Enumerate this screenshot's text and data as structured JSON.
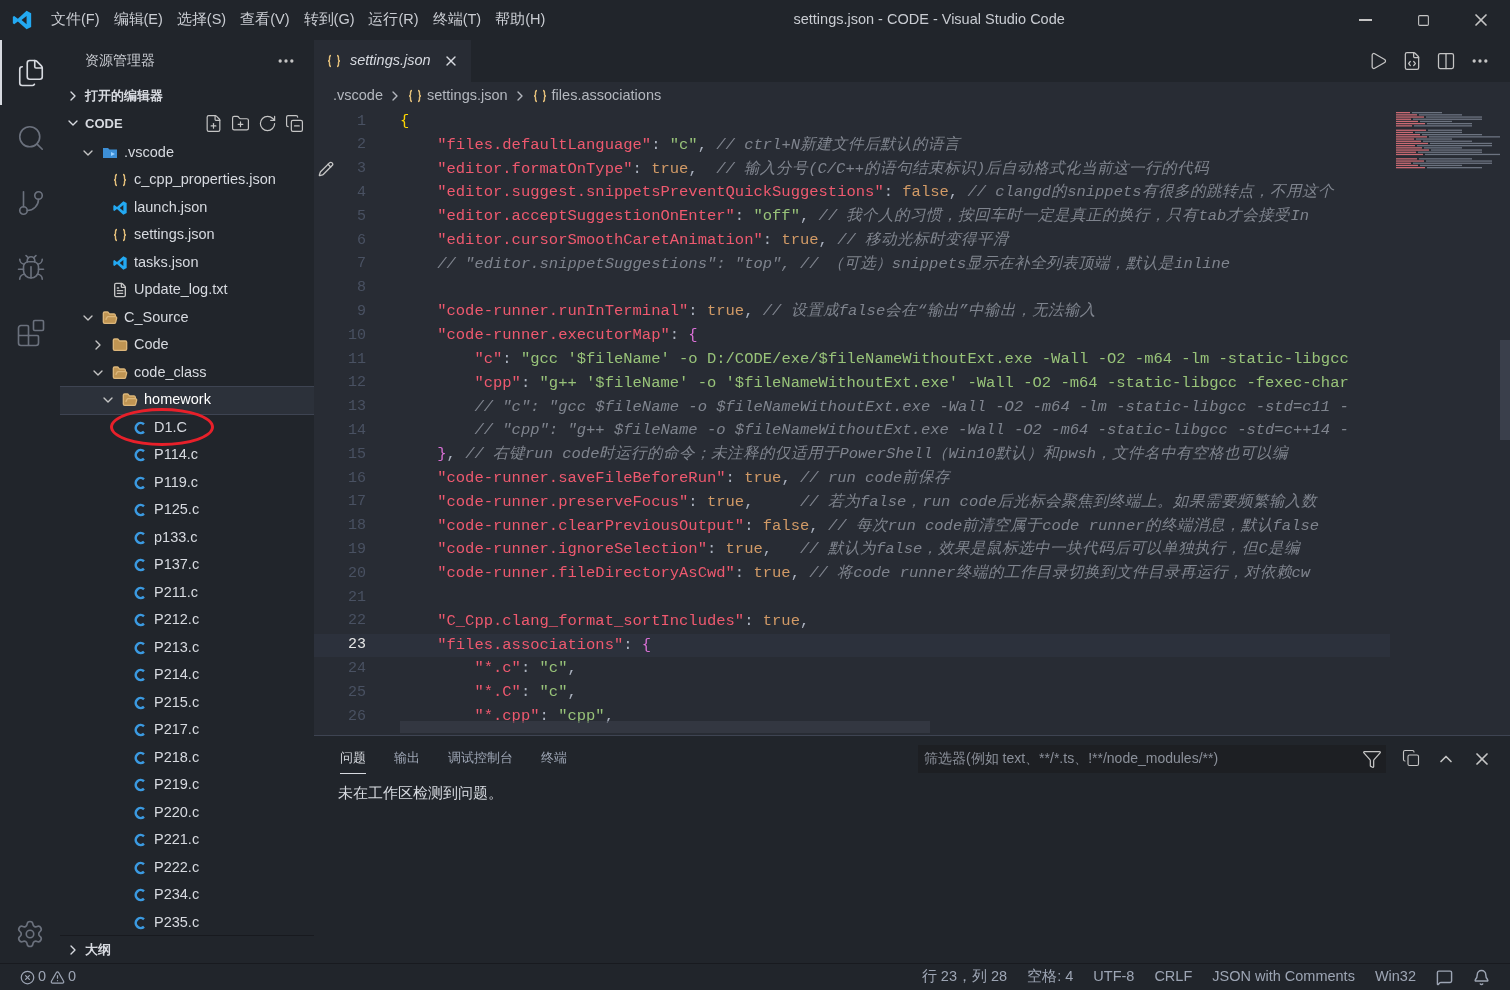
{
  "window": {
    "title": "settings.json - CODE - Visual Studio Code"
  },
  "menu": [
    "文件(F)",
    "编辑(E)",
    "选择(S)",
    "查看(V)",
    "转到(G)",
    "运行(R)",
    "终端(T)",
    "帮助(H)"
  ],
  "activity_bar": [
    {
      "kind": "files",
      "selected": true
    },
    {
      "kind": "search",
      "selected": false
    },
    {
      "kind": "source-control",
      "selected": false
    },
    {
      "kind": "run-debug",
      "selected": false
    },
    {
      "kind": "extensions",
      "selected": false
    }
  ],
  "sidebar": {
    "title": "资源管理器",
    "sections": [
      {
        "label": "打开的编辑器",
        "expanded": false
      },
      {
        "label": "CODE",
        "expanded": true
      }
    ],
    "tree": [
      {
        "name": ".vscode",
        "kind": "vscode-folder",
        "expanded": true,
        "selected": false,
        "children": [
          {
            "name": "c_cpp_properties.json",
            "kind": "json",
            "selected": false
          },
          {
            "name": "launch.json",
            "kind": "vscode",
            "selected": false
          },
          {
            "name": "settings.json",
            "kind": "json",
            "selected": false
          },
          {
            "name": "tasks.json",
            "kind": "vscode",
            "selected": false
          },
          {
            "name": "Update_log.txt",
            "kind": "text",
            "selected": false
          }
        ]
      },
      {
        "name": "C_Source",
        "kind": "folder",
        "expanded": true,
        "selected": false,
        "children": [
          {
            "name": "Code",
            "kind": "folder",
            "expanded": false,
            "selected": false
          },
          {
            "name": "code_class",
            "kind": "folder",
            "expanded": true,
            "selected": false,
            "children": [
              {
                "name": "homework",
                "kind": "folder",
                "expanded": true,
                "selected": true,
                "children": [
                  {
                    "name": "D1.C",
                    "kind": "c",
                    "selected": false,
                    "circled": true
                  },
                  {
                    "name": "P114.c",
                    "kind": "c",
                    "selected": false
                  },
                  {
                    "name": "P119.c",
                    "kind": "c",
                    "selected": false
                  },
                  {
                    "name": "P125.c",
                    "kind": "c",
                    "selected": false
                  },
                  {
                    "name": "p133.c",
                    "kind": "c",
                    "selected": false
                  },
                  {
                    "name": "P137.c",
                    "kind": "c",
                    "selected": false
                  },
                  {
                    "name": "P211.c",
                    "kind": "c",
                    "selected": false
                  },
                  {
                    "name": "P212.c",
                    "kind": "c",
                    "selected": false
                  },
                  {
                    "name": "P213.c",
                    "kind": "c",
                    "selected": false
                  },
                  {
                    "name": "P214.c",
                    "kind": "c",
                    "selected": false
                  },
                  {
                    "name": "P215.c",
                    "kind": "c",
                    "selected": false
                  },
                  {
                    "name": "P217.c",
                    "kind": "c",
                    "selected": false
                  },
                  {
                    "name": "P218.c",
                    "kind": "c",
                    "selected": false
                  },
                  {
                    "name": "P219.c",
                    "kind": "c",
                    "selected": false
                  },
                  {
                    "name": "P220.c",
                    "kind": "c",
                    "selected": false
                  },
                  {
                    "name": "P221.c",
                    "kind": "c",
                    "selected": false
                  },
                  {
                    "name": "P222.c",
                    "kind": "c",
                    "selected": false
                  },
                  {
                    "name": "P234.c",
                    "kind": "c",
                    "selected": false
                  },
                  {
                    "name": "P235.c",
                    "kind": "c",
                    "selected": false
                  }
                ]
              }
            ]
          }
        ]
      }
    ],
    "outline": {
      "label": "大纲",
      "expanded": false
    }
  },
  "editor": {
    "tabs": [
      {
        "label": "settings.json",
        "selected": true,
        "preview": true
      }
    ],
    "breadcrumb": [
      {
        "label": ".vscode",
        "kind": "folder"
      },
      {
        "label": "settings.json",
        "kind": "json"
      },
      {
        "label": "files.associations",
        "kind": "json"
      }
    ],
    "lines": [
      {
        "number": "1",
        "current": false,
        "tokens": [
          {
            "kind": "bracket1",
            "text": "{"
          }
        ]
      },
      {
        "number": "2",
        "current": false,
        "tokens": [
          {
            "kind": "key",
            "text": "    \"files.defaultLanguage\""
          },
          {
            "kind": "punct",
            "text": ": "
          },
          {
            "kind": "string",
            "text": "\"c\""
          },
          {
            "kind": "punct",
            "text": ", "
          },
          {
            "kind": "comment",
            "text": "// ctrl+N新建文件后默认的语言"
          }
        ]
      },
      {
        "number": "3",
        "current": false,
        "edited": true,
        "tokens": [
          {
            "kind": "key",
            "text": "    \"editor.formatOnType\""
          },
          {
            "kind": "punct",
            "text": ": "
          },
          {
            "kind": "literal",
            "text": "true"
          },
          {
            "kind": "punct",
            "text": ",  "
          },
          {
            "kind": "comment",
            "text": "// 输入分号(C/C++的语句结束标识)后自动格式化当前这一行的代码"
          }
        ]
      },
      {
        "number": "4",
        "current": false,
        "tokens": [
          {
            "kind": "key",
            "text": "    \"editor.suggest.snippetsPreventQuickSuggestions\""
          },
          {
            "kind": "punct",
            "text": ": "
          },
          {
            "kind": "literal",
            "text": "false"
          },
          {
            "kind": "punct",
            "text": ", "
          },
          {
            "kind": "comment",
            "text": "// clangd的snippets有很多的跳转点，不用这个"
          }
        ]
      },
      {
        "number": "5",
        "current": false,
        "tokens": [
          {
            "kind": "key",
            "text": "    \"editor.acceptSuggestionOnEnter\""
          },
          {
            "kind": "punct",
            "text": ": "
          },
          {
            "kind": "string",
            "text": "\"off\""
          },
          {
            "kind": "punct",
            "text": ", "
          },
          {
            "kind": "comment",
            "text": "// 我个人的习惯，按回车时一定是真正的换行，只有tab才会接受In"
          }
        ]
      },
      {
        "number": "6",
        "current": false,
        "tokens": [
          {
            "kind": "key",
            "text": "    \"editor.cursorSmoothCaretAnimation\""
          },
          {
            "kind": "punct",
            "text": ": "
          },
          {
            "kind": "literal",
            "text": "true"
          },
          {
            "kind": "punct",
            "text": ", "
          },
          {
            "kind": "comment",
            "text": "// 移动光标时变得平滑"
          }
        ]
      },
      {
        "number": "7",
        "current": false,
        "tokens": [
          {
            "kind": "comment",
            "text": "    // \"editor.snippetSuggestions\": \"top\", // （可选）snippets显示在补全列表顶端，默认是inline"
          }
        ]
      },
      {
        "number": "8",
        "current": false
      },
      {
        "number": "9",
        "current": false,
        "tokens": [
          {
            "kind": "key",
            "text": "    \"code-runner.runInTerminal\""
          },
          {
            "kind": "punct",
            "text": ": "
          },
          {
            "kind": "literal",
            "text": "true"
          },
          {
            "kind": "punct",
            "text": ", "
          },
          {
            "kind": "comment",
            "text": "// 设置成false会在“输出”中输出，无法输入"
          }
        ]
      },
      {
        "number": "10",
        "current": false,
        "tokens": [
          {
            "kind": "key",
            "text": "    \"code-runner.executorMap\""
          },
          {
            "kind": "punct",
            "text": ": "
          },
          {
            "kind": "bracket2",
            "text": "{"
          }
        ]
      },
      {
        "number": "11",
        "current": false,
        "tokens": [
          {
            "kind": "key",
            "text": "        \"c\""
          },
          {
            "kind": "punct",
            "text": ": "
          },
          {
            "kind": "string",
            "text": "\"gcc '$fileName' -o D:/CODE/exe/$fileNameWithoutExt.exe -Wall -O2 -m64 -lm -static-libgcc"
          }
        ]
      },
      {
        "number": "12",
        "current": false,
        "tokens": [
          {
            "kind": "key",
            "text": "        \"cpp\""
          },
          {
            "kind": "punct",
            "text": ": "
          },
          {
            "kind": "string",
            "text": "\"g++ '$fileName' -o '$fileNameWithoutExt.exe' -Wall -O2 -m64 -static-libgcc -fexec-char"
          }
        ]
      },
      {
        "number": "13",
        "current": false,
        "tokens": [
          {
            "kind": "comment",
            "text": "        // \"c\": \"gcc $fileName -o $fileNameWithoutExt.exe -Wall -O2 -m64 -lm -static-libgcc -std=c11 -"
          }
        ]
      },
      {
        "number": "14",
        "current": false,
        "tokens": [
          {
            "kind": "comment",
            "text": "        // \"cpp\": \"g++ $fileName -o $fileNameWithoutExt.exe -Wall -O2 -m64 -static-libgcc -std=c++14 -"
          }
        ]
      },
      {
        "number": "15",
        "current": false,
        "tokens": [
          {
            "kind": "bracket2",
            "text": "    }"
          },
          {
            "kind": "punct",
            "text": ", "
          },
          {
            "kind": "comment",
            "text": "// 右键run code时运行的命令；未注释的仅适用于PowerShell（Win10默认）和pwsh，文件名中有空格也可以编"
          }
        ]
      },
      {
        "number": "16",
        "current": false,
        "tokens": [
          {
            "kind": "key",
            "text": "    \"code-runner.saveFileBeforeRun\""
          },
          {
            "kind": "punct",
            "text": ": "
          },
          {
            "kind": "literal",
            "text": "true"
          },
          {
            "kind": "punct",
            "text": ", "
          },
          {
            "kind": "comment",
            "text": "// run code前保存"
          }
        ]
      },
      {
        "number": "17",
        "current": false,
        "tokens": [
          {
            "kind": "key",
            "text": "    \"code-runner.preserveFocus\""
          },
          {
            "kind": "punct",
            "text": ": "
          },
          {
            "kind": "literal",
            "text": "true"
          },
          {
            "kind": "punct",
            "text": ",     "
          },
          {
            "kind": "comment",
            "text": "// 若为false，run code后光标会聚焦到终端上。如果需要频繁输入数"
          }
        ]
      },
      {
        "number": "18",
        "current": false,
        "tokens": [
          {
            "kind": "key",
            "text": "    \"code-runner.clearPreviousOutput\""
          },
          {
            "kind": "punct",
            "text": ": "
          },
          {
            "kind": "literal",
            "text": "false"
          },
          {
            "kind": "punct",
            "text": ", "
          },
          {
            "kind": "comment",
            "text": "// 每次run code前清空属于code runner的终端消息，默认false"
          }
        ]
      },
      {
        "number": "19",
        "current": false,
        "tokens": [
          {
            "kind": "key",
            "text": "    \"code-runner.ignoreSelection\""
          },
          {
            "kind": "punct",
            "text": ": "
          },
          {
            "kind": "literal",
            "text": "true"
          },
          {
            "kind": "punct",
            "text": ",   "
          },
          {
            "kind": "comment",
            "text": "// 默认为false，效果是鼠标选中一块代码后可以单独执行，但C是编"
          }
        ]
      },
      {
        "number": "20",
        "current": false,
        "tokens": [
          {
            "kind": "key",
            "text": "    \"code-runner.fileDirectoryAsCwd\""
          },
          {
            "kind": "punct",
            "text": ": "
          },
          {
            "kind": "literal",
            "text": "true"
          },
          {
            "kind": "punct",
            "text": ", "
          },
          {
            "kind": "comment",
            "text": "// 将code runner终端的工作目录切换到文件目录再运行，对依赖cw"
          }
        ]
      },
      {
        "number": "21",
        "current": false
      },
      {
        "number": "22",
        "current": false,
        "tokens": [
          {
            "kind": "key",
            "text": "    \"C_Cpp.clang_format_sortIncludes\""
          },
          {
            "kind": "punct",
            "text": ": "
          },
          {
            "kind": "literal",
            "text": "true"
          },
          {
            "kind": "punct",
            "text": ","
          }
        ]
      },
      {
        "number": "23",
        "current": true,
        "tokens": [
          {
            "kind": "key",
            "text": "    \"files.associations\""
          },
          {
            "kind": "punct",
            "text": ": "
          },
          {
            "kind": "bracket2",
            "text": "{"
          }
        ]
      },
      {
        "number": "24",
        "current": false,
        "tokens": [
          {
            "kind": "key",
            "text": "        \"*.c\""
          },
          {
            "kind": "punct",
            "text": ": "
          },
          {
            "kind": "string",
            "text": "\"c\""
          },
          {
            "kind": "punct",
            "text": ","
          }
        ]
      },
      {
        "number": "25",
        "current": false,
        "tokens": [
          {
            "kind": "key",
            "text": "        \"*.C\""
          },
          {
            "kind": "punct",
            "text": ": "
          },
          {
            "kind": "string",
            "text": "\"c\""
          },
          {
            "kind": "punct",
            "text": ","
          }
        ]
      },
      {
        "number": "26",
        "current": false,
        "tokens": [
          {
            "kind": "key",
            "text": "        \"*.cpp\""
          },
          {
            "kind": "punct",
            "text": ": "
          },
          {
            "kind": "string",
            "text": "\"cpp\""
          },
          {
            "kind": "punct",
            "text": ","
          }
        ]
      }
    ]
  },
  "panel": {
    "tabs": [
      {
        "label": "问题",
        "selected": true
      },
      {
        "label": "输出",
        "selected": false
      },
      {
        "label": "调试控制台",
        "selected": false
      },
      {
        "label": "终端",
        "selected": false
      }
    ],
    "filter": {
      "placeholder": "筛选器(例如 text、**/*.ts、!**/node_modules/**)"
    },
    "message": "未在工作区检测到问题。"
  },
  "status_bar": {
    "errors": "0",
    "warnings": "0",
    "items": [
      "行 23，列 28",
      "空格: 4",
      "UTF-8",
      "CRLF",
      "JSON with Comments",
      "Win32"
    ]
  }
}
